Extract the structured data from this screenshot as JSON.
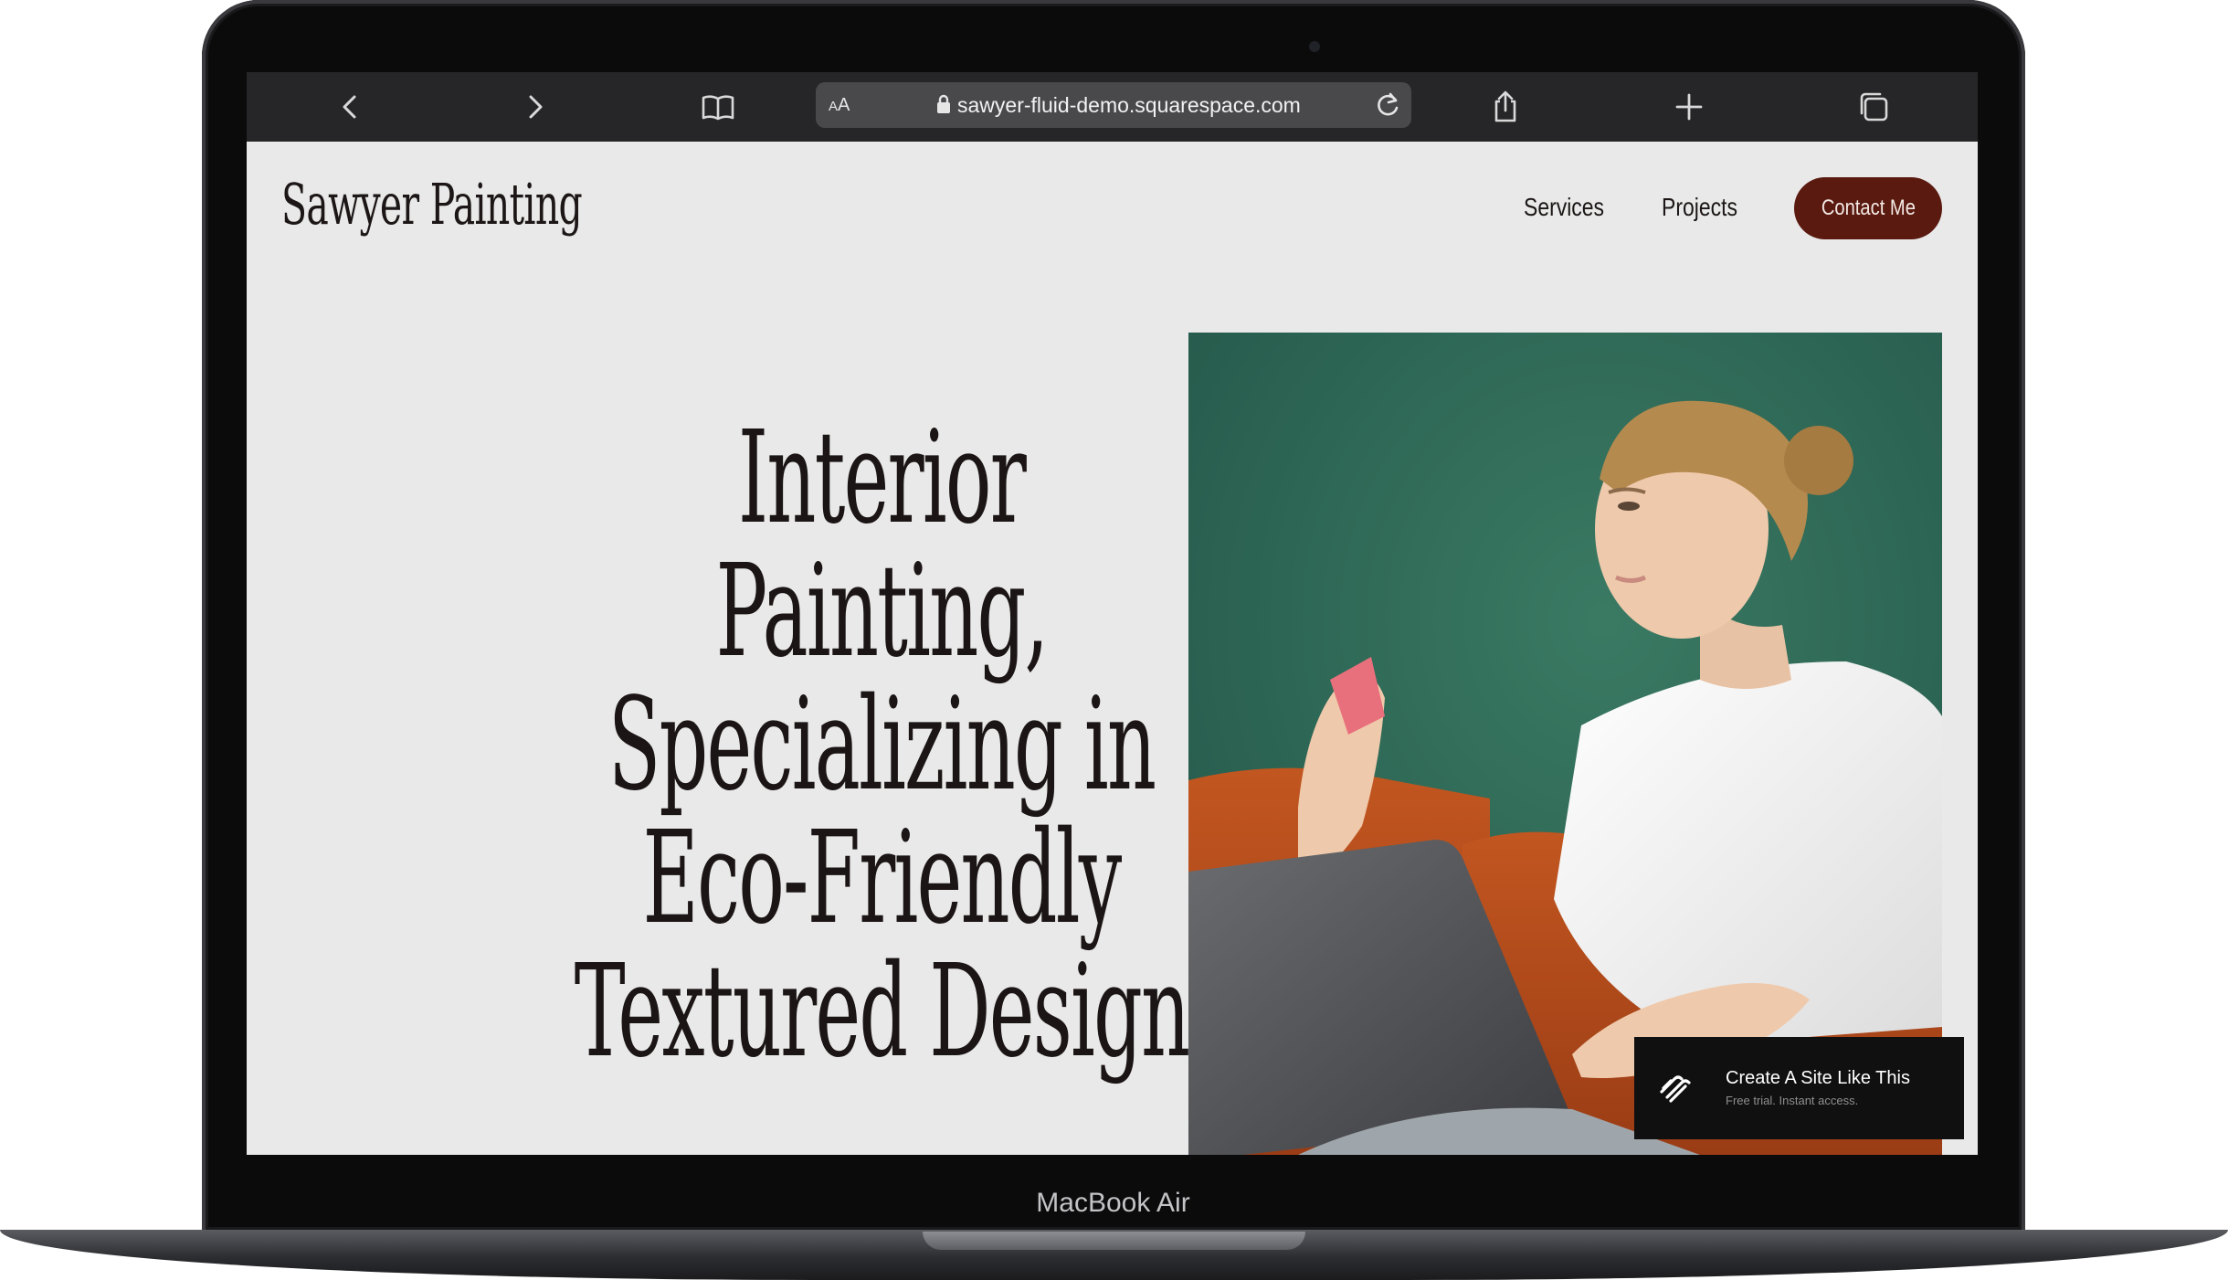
{
  "device": {
    "model_label": "MacBook Air"
  },
  "browser": {
    "text_size_label_small": "A",
    "text_size_label_large": "A",
    "url": "sawyer-fluid-demo.squarespace.com",
    "icons": {
      "back": "chevron-left-icon",
      "forward": "chevron-right-icon",
      "bookmarks": "book-icon",
      "lock": "lock-icon",
      "reload": "reload-icon",
      "share": "share-icon",
      "new_tab": "plus-icon",
      "tabs": "tabs-icon"
    }
  },
  "site": {
    "brand": "Sawyer Painting",
    "nav": {
      "services": "Services",
      "projects": "Projects",
      "contact": "Contact Me"
    },
    "hero": {
      "lines": [
        "Interior",
        "Painting,",
        "Specializing in",
        "Eco-Friendly",
        "Textured Design"
      ]
    },
    "colors": {
      "background": "#e9e9e9",
      "text": "#1c1515",
      "accent_button": "#5a1a10",
      "photo_wall": "#2e6a55",
      "photo_sofa": "#b14a1c"
    }
  },
  "squarespace_badge": {
    "title": "Create A Site Like This",
    "subtitle": "Free trial. Instant access.",
    "icon": "squarespace-logo-icon"
  }
}
